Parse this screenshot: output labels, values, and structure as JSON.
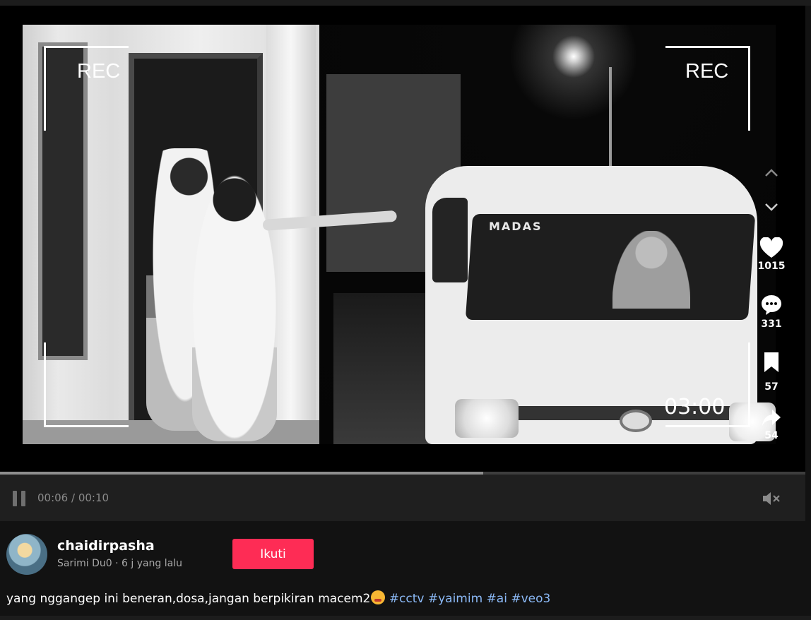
{
  "video": {
    "overlay": {
      "rec_left": "REC",
      "rec_right": "REC",
      "timecode": "03:00",
      "van_text": "MADAS"
    }
  },
  "rail": {
    "likes": "1015",
    "comments": "331",
    "saves": "57",
    "shares": "54"
  },
  "player": {
    "time": "00:06 / 00:10",
    "progress_fraction": 0.6
  },
  "post": {
    "username": "chaidirpasha",
    "subline": "Sarimi Du0 · 6 j yang lalu",
    "follow_label": "Ikuti",
    "caption_text": "yang nggangep ini beneran,dosa,jangan berpikiran macem2",
    "hashtags": [
      "#cctv",
      "#yaimim",
      "#ai",
      "#veo3"
    ]
  },
  "colors": {
    "accent": "#fe2c55",
    "hashtag": "#8bb9f6"
  },
  "icons": [
    "chevron-up-icon",
    "chevron-down-icon",
    "heart-icon",
    "comment-icon",
    "bookmark-icon",
    "share-icon",
    "pause-icon",
    "mute-icon"
  ]
}
